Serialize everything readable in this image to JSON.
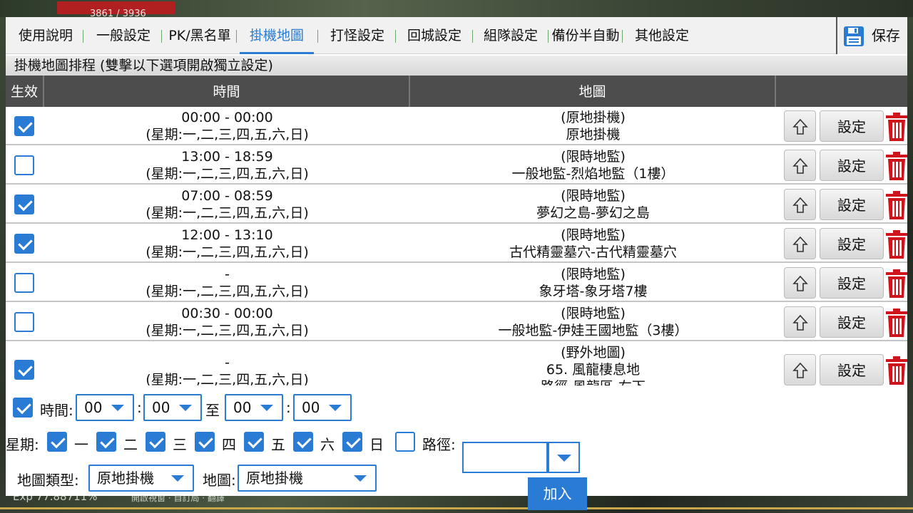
{
  "background": {
    "hp_text": "3861 / 3936",
    "exp_text": "Exp 77.88711%",
    "bottom_text": "開啟視窗 · 自訂局 · 翻譯"
  },
  "tabs": [
    {
      "label": "使用說明",
      "active": false
    },
    {
      "label": "一般設定",
      "active": false
    },
    {
      "label": "PK/黑名單",
      "active": false
    },
    {
      "label": "掛機地圖",
      "active": true
    },
    {
      "label": "打怪設定",
      "active": false
    },
    {
      "label": "回城設定",
      "active": false
    },
    {
      "label": "組隊設定",
      "active": false
    },
    {
      "label": "備份半自動",
      "active": false
    },
    {
      "label": "其他設定",
      "active": false
    }
  ],
  "save_label": "保存",
  "section_title": "掛機地圖排程 (雙擊以下選項開啟獨立設定)",
  "table": {
    "headers": [
      "生效",
      "時間",
      "地圖",
      ""
    ],
    "set_label": "設定",
    "rows": [
      {
        "enabled": true,
        "time": "00:00 - 00:00",
        "days": "(星期:一,二,三,四,五,六,日)",
        "map_type": "(原地掛機)",
        "map_name": "原地掛機",
        "map_extra": ""
      },
      {
        "enabled": false,
        "time": "13:00 - 18:59",
        "days": "(星期:一,二,三,四,五,六,日)",
        "map_type": "(限時地監)",
        "map_name": "一般地監-烈焰地監（1樓）",
        "map_extra": ""
      },
      {
        "enabled": true,
        "time": "07:00 - 08:59",
        "days": "(星期:一,二,三,四,五,六,日)",
        "map_type": "(限時地監)",
        "map_name": "夢幻之島-夢幻之島",
        "map_extra": ""
      },
      {
        "enabled": true,
        "time": "12:00 - 13:10",
        "days": "(星期:一,二,三,四,五,六,日)",
        "map_type": "(限時地監)",
        "map_name": "古代精靈墓穴-古代精靈墓穴",
        "map_extra": ""
      },
      {
        "enabled": false,
        "time": "-",
        "days": "(星期:一,二,三,四,五,六,日)",
        "map_type": "(限時地監)",
        "map_name": "象牙塔-象牙塔7樓",
        "map_extra": ""
      },
      {
        "enabled": false,
        "time": "00:30 - 00:00",
        "days": "(星期:一,二,三,四,五,六,日)",
        "map_type": "(限時地監)",
        "map_name": "一般地監-伊娃王國地監（3樓）",
        "map_extra": ""
      },
      {
        "enabled": true,
        "time": "-",
        "days": "(星期:一,二,三,四,五,六,日)",
        "map_type": "(野外地圖)",
        "map_name": "65. 風龍棲息地",
        "map_extra": "路徑-風龍區-右下"
      }
    ]
  },
  "controls": {
    "time_enabled": true,
    "time_label": "時間:",
    "start_hour": "00",
    "start_min": "00",
    "to_label": "至",
    "end_hour": "00",
    "end_min": "00",
    "colon": ":",
    "week_label": "星期:",
    "days": [
      {
        "label": "一",
        "checked": true
      },
      {
        "label": "二",
        "checked": true
      },
      {
        "label": "三",
        "checked": true
      },
      {
        "label": "四",
        "checked": true
      },
      {
        "label": "五",
        "checked": true
      },
      {
        "label": "六",
        "checked": true
      },
      {
        "label": "日",
        "checked": true
      }
    ],
    "path_enabled": false,
    "path_label": "路徑:",
    "path_value": "",
    "map_type_label": "地圖類型:",
    "map_type_value": "原地掛機",
    "map_label": "地圖:",
    "map_value": "原地掛機",
    "add_label": "加入"
  },
  "colors": {
    "accent": "#2a7bd3",
    "header_bg": "#4d4d4d",
    "delete": "#d0141c"
  }
}
